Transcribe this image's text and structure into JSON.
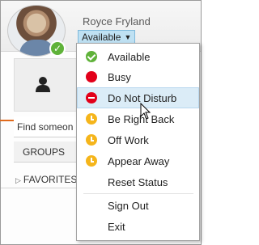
{
  "user": {
    "name": "Royce Fryland",
    "status": "Available"
  },
  "colors": {
    "available": "#5fb239",
    "busy": "#e2001a",
    "away": "#f5b51b",
    "accent_orange": "#e06a1c",
    "hover": "#dbecf7"
  },
  "icons": {
    "status_dropdown": "chevron-down-icon",
    "contact_tile": "person-icon",
    "favorites_expander": "triangle-right-icon"
  },
  "left_panel": {
    "find_placeholder": "Find someon",
    "groups_tab": "GROUPS",
    "favorites": "FAVORITES"
  },
  "menu": {
    "items": [
      {
        "label": "Available",
        "icon": "available-check-icon"
      },
      {
        "label": "Busy",
        "icon": "busy-dot-icon"
      },
      {
        "label": "Do Not Disturb",
        "icon": "do-not-disturb-icon",
        "hovered": true
      },
      {
        "label": "Be Right Back",
        "icon": "away-clock-icon"
      },
      {
        "label": "Off Work",
        "icon": "away-clock-icon"
      },
      {
        "label": "Appear Away",
        "icon": "away-clock-icon"
      },
      {
        "label": "Reset Status"
      },
      {
        "label": "Sign Out"
      },
      {
        "label": "Exit"
      }
    ]
  }
}
